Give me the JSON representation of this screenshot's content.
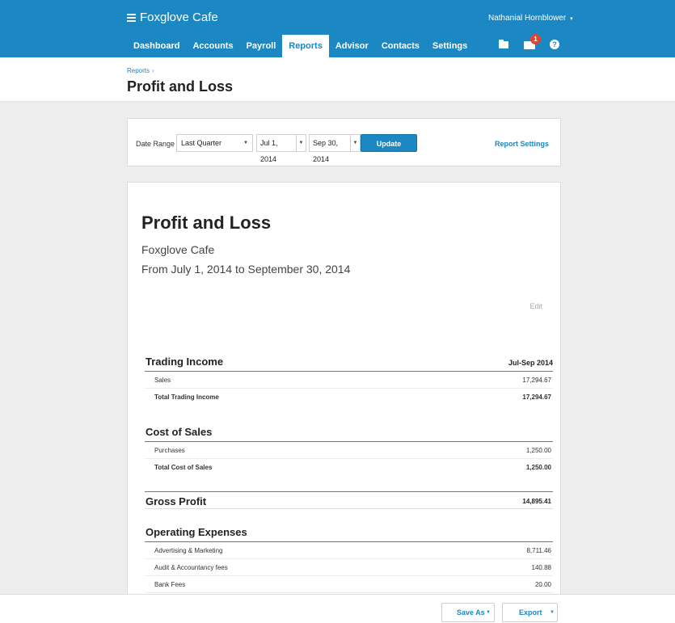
{
  "app": {
    "org_name": "Foxglove Cafe",
    "user_name": "Nathanial Hornblower"
  },
  "nav": {
    "tabs": [
      "Dashboard",
      "Accounts",
      "Payroll",
      "Reports",
      "Advisor",
      "Contacts",
      "Settings"
    ],
    "active": "Reports"
  },
  "header_icons": {
    "folder": "folder-icon",
    "mail": "mail-icon",
    "mail_badge": "1",
    "help": "?"
  },
  "breadcrumb": {
    "parent": "Reports",
    "separator": "›"
  },
  "page": {
    "title": "Profit and Loss"
  },
  "filters": {
    "date_range_label": "Date Range",
    "preset": "Last Quarter",
    "from_date": "Jul 1, 2014",
    "to_date": "Sep 30, 2014",
    "update_label": "Update",
    "report_settings_label": "Report Settings"
  },
  "report": {
    "title": "Profit and Loss",
    "org": "Foxglove Cafe",
    "period": "From July 1, 2014 to September 30, 2014",
    "edit_label": "Edit",
    "column": "Jul-Sep 2014",
    "trading_income": {
      "heading": "Trading Income",
      "rows": [
        {
          "label": "Sales",
          "amount": "17,294.67"
        }
      ],
      "total": {
        "label": "Total Trading Income",
        "amount": "17,294.67"
      }
    },
    "cost_of_sales": {
      "heading": "Cost of Sales",
      "rows": [
        {
          "label": "Purchases",
          "amount": "1,250.00"
        }
      ],
      "total": {
        "label": "Total Cost of Sales",
        "amount": "1,250.00"
      }
    },
    "gross_profit": {
      "label": "Gross Profit",
      "amount": "14,895.41"
    },
    "operating_expenses": {
      "heading": "Operating Expenses",
      "rows": [
        {
          "label": "Advertising & Marketing",
          "amount": "8,711.46"
        },
        {
          "label": "Audit & Accountancy fees",
          "amount": "140.88"
        },
        {
          "label": "Bank Fees",
          "amount": "20.00"
        }
      ]
    }
  },
  "footer": {
    "save_as_label": "Save As",
    "export_label": "Export"
  },
  "colors": {
    "brand_blue": "#1b87c3",
    "badge_red": "#e0462e"
  }
}
